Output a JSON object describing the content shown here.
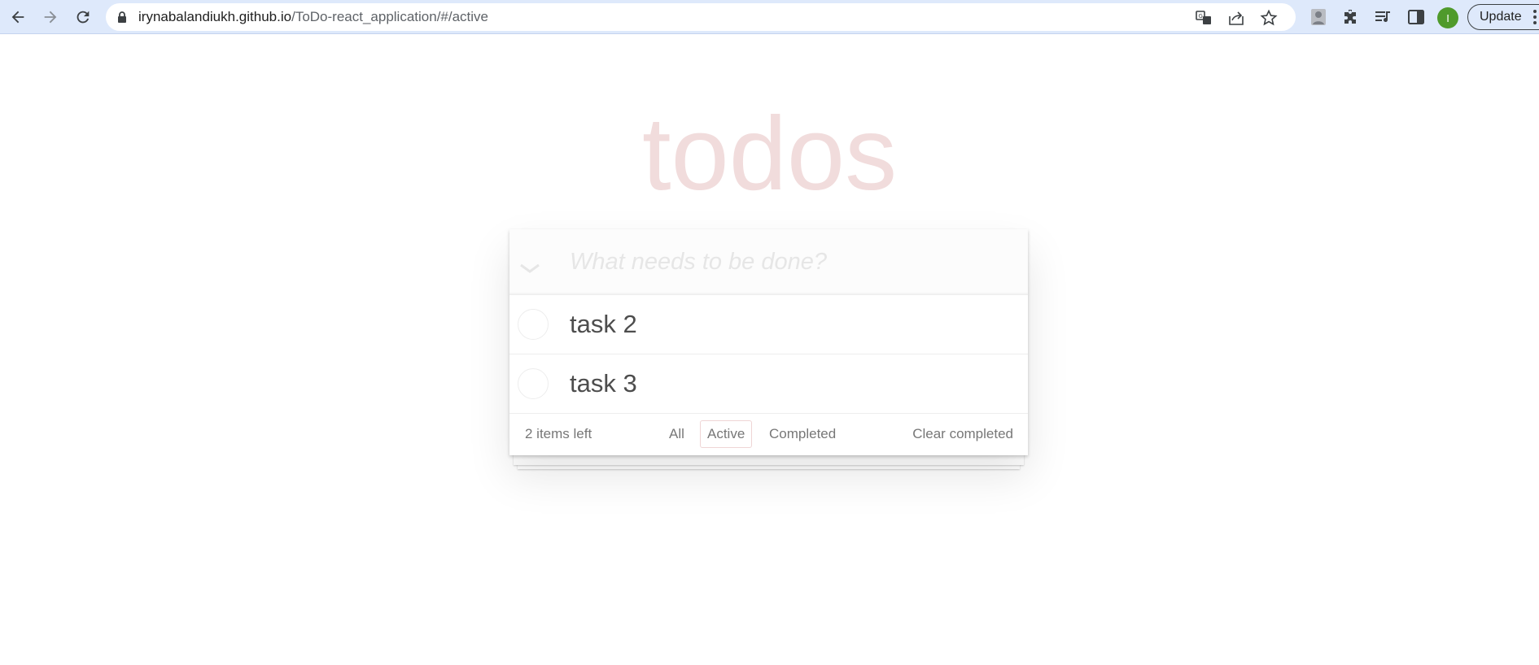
{
  "browser": {
    "url_host": "irynabalandiukh.github.io",
    "url_path": "/ToDo-react_application/#/active",
    "avatar_letter": "I",
    "update_label": "Update"
  },
  "app": {
    "title": "todos",
    "new_todo_placeholder": "What needs to be done?",
    "todos": [
      {
        "text": "task 2",
        "completed": false
      },
      {
        "text": "task 3",
        "completed": false
      }
    ],
    "footer": {
      "items_left": "2 items left",
      "filters": [
        "All",
        "Active",
        "Completed"
      ],
      "selected_filter": "Active",
      "clear_label": "Clear completed"
    }
  },
  "colors": {
    "title": "#f1dcdc",
    "text": "#4d4d4d",
    "muted": "#777777",
    "chrome": "#dee9fb"
  }
}
